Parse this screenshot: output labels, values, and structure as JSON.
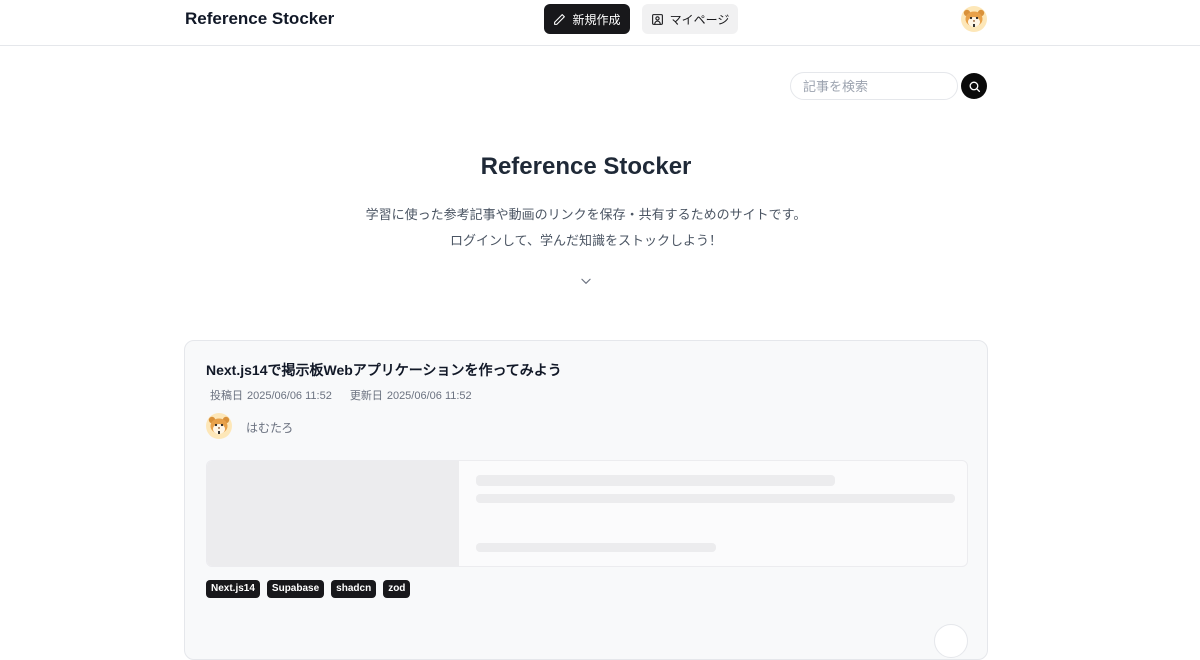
{
  "header": {
    "logo": "Reference Stocker",
    "new_button_label": "新規作成",
    "mypage_button_label": "マイページ",
    "new_button_icon": "pencil-icon",
    "mypage_button_icon": "user-square-icon"
  },
  "search": {
    "placeholder": "記事を検索",
    "value": "",
    "icon": "search-icon"
  },
  "hero": {
    "title": "Reference Stocker",
    "line1": "学習に使った参考記事や動画のリンクを保存・共有するためのサイトです。",
    "line2": "ログインして、学んだ知識をストックしよう！",
    "scroll_icon": "chevron-down-icon"
  },
  "article": {
    "title": "Next.js14で掲示板Webアプリケーションを作ってみよう",
    "posted_label": "投稿日",
    "posted_value": "2025/06/06 11:52",
    "updated_label": "更新日",
    "updated_value": "2025/06/06 11:52",
    "author": "はむたろ",
    "tags": [
      "Next.js14",
      "Supabase",
      "shadcn",
      "zod"
    ]
  },
  "colors": {
    "primary": "#18181b",
    "card_bg": "#f8f9fa",
    "muted_text": "#6b7280",
    "skeleton": "#ececee"
  }
}
